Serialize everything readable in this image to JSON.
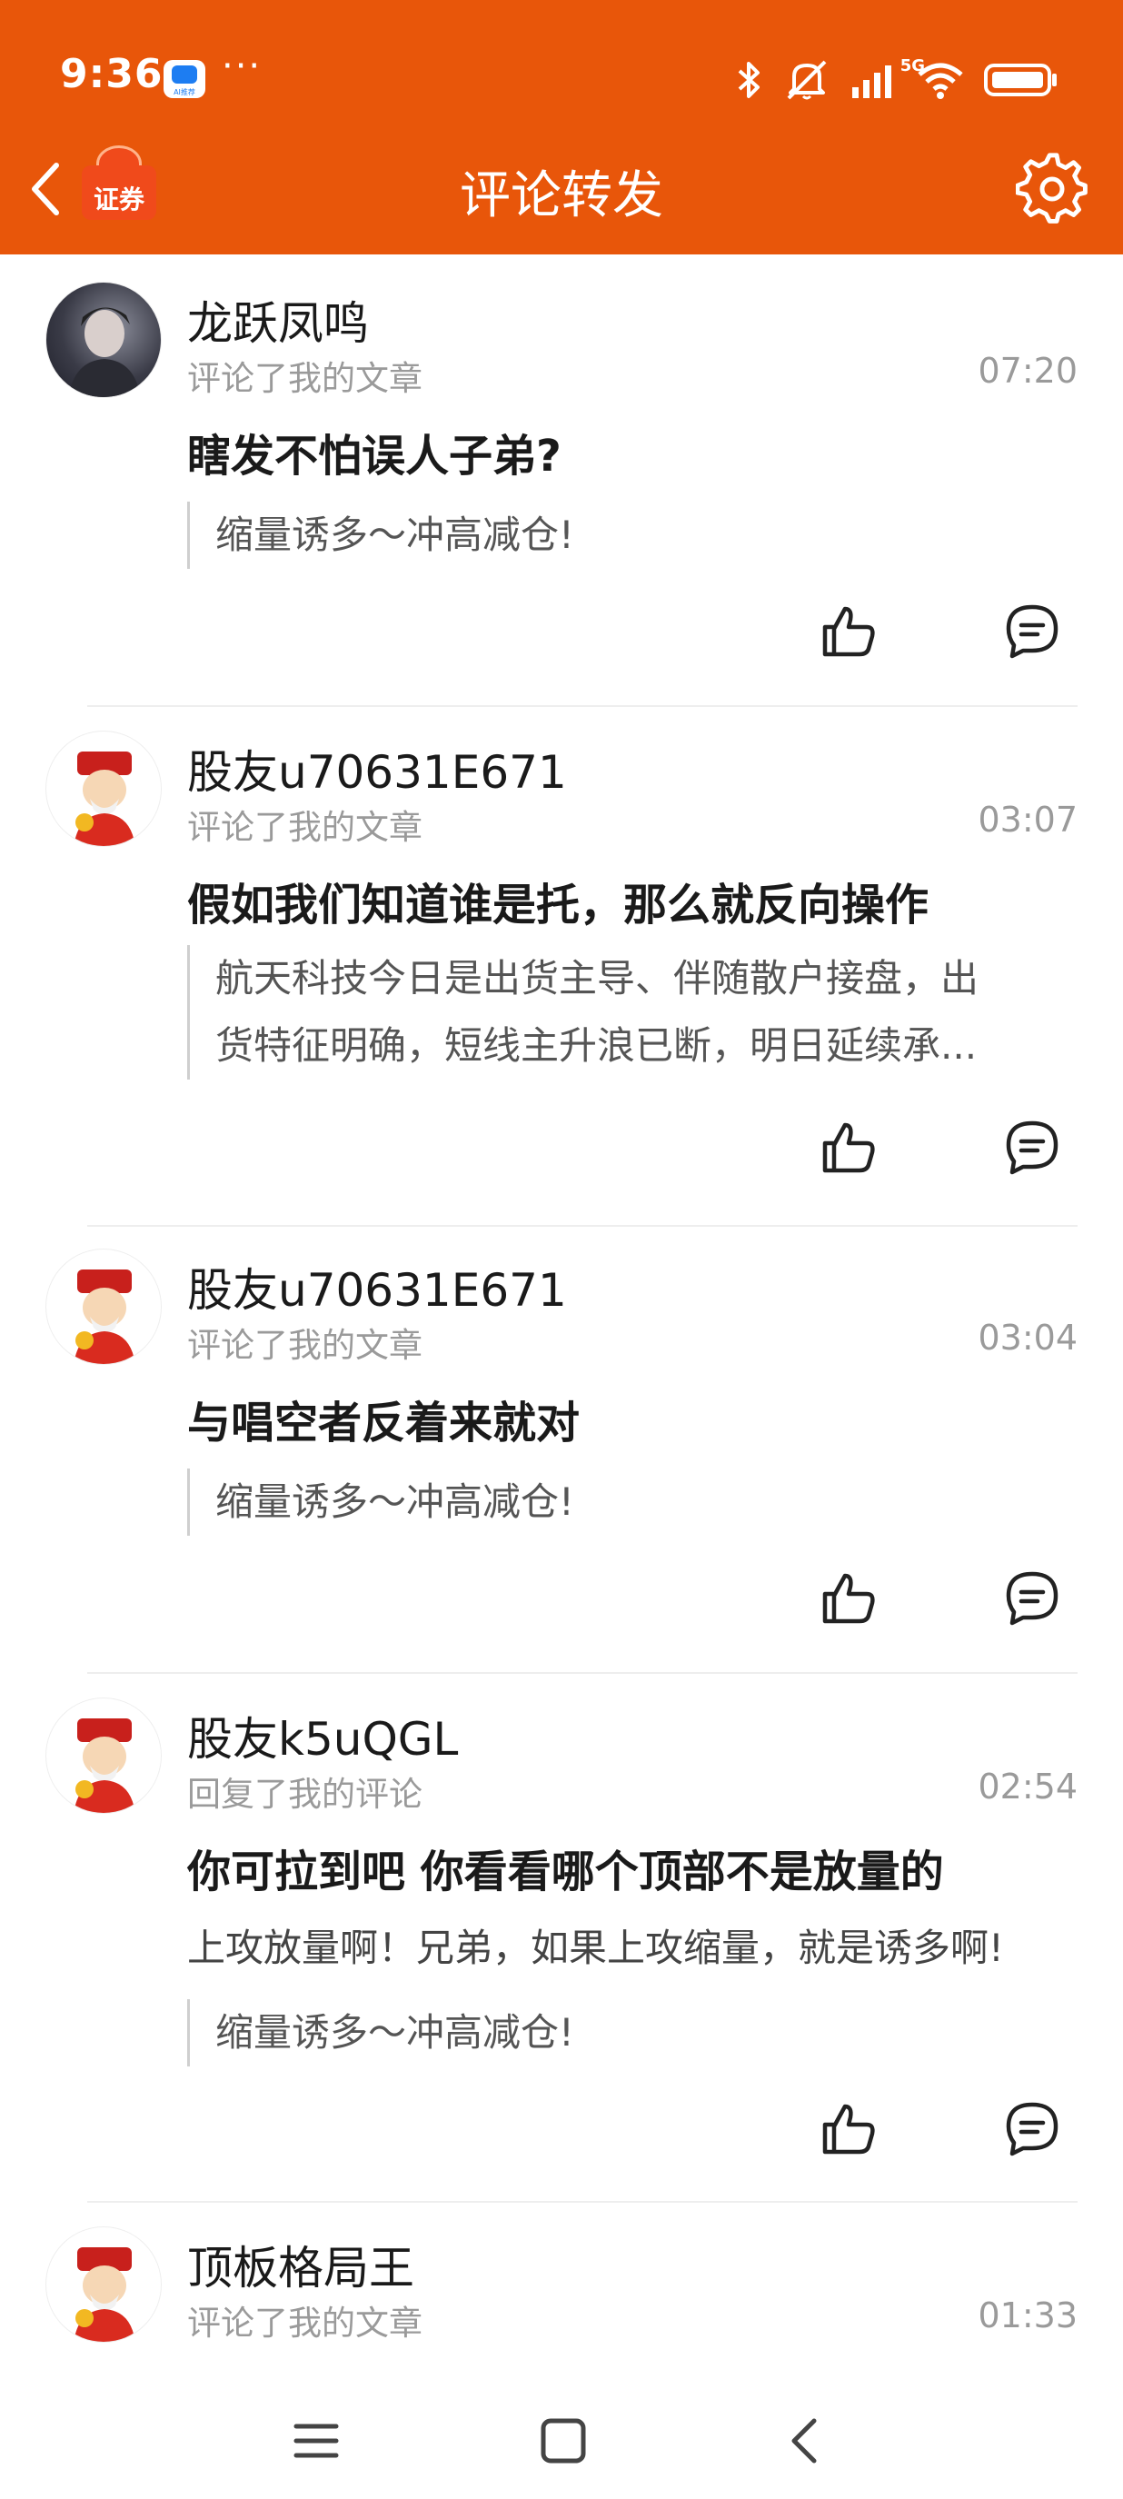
{
  "status_bar": {
    "time": "9:36",
    "app_icon_label": "AI推荐",
    "more_dots": "···",
    "network": "5G"
  },
  "header": {
    "logo_text": "证券",
    "title": "评论转发"
  },
  "items": [
    {
      "username": "龙跃凤鸣",
      "action": "评论了我的文章",
      "time": "07:20",
      "comment": "瞎发不怕误人子弟?",
      "reply": "",
      "quote_lines": [
        "缩量诱多～冲高减仓!"
      ]
    },
    {
      "username": "股友u70631E671",
      "action": "评论了我的文章",
      "time": "03:07",
      "comment": "假如我们知道谁是托，那么就反向操作",
      "reply": "",
      "quote_lines": [
        "航天科技今日是出货主导、伴随散户接盘，出",
        "货特征明确，短线主升浪已断，明日延续承..."
      ]
    },
    {
      "username": "股友u70631E671",
      "action": "评论了我的文章",
      "time": "03:04",
      "comment": "与唱空者反着来就对",
      "reply": "",
      "quote_lines": [
        "缩量诱多～冲高减仓!"
      ]
    },
    {
      "username": "股友k5uQGL",
      "action": "回复了我的评论",
      "time": "02:54",
      "comment": "你可拉到吧 你看看哪个顶部不是放量的",
      "reply": "上攻放量啊！兄弟，如果上攻缩量，就是诱多啊!",
      "quote_lines": [
        "缩量诱多～冲高减仓!"
      ]
    },
    {
      "username": "顶板格局王",
      "action": "评论了我的文章",
      "time": "01:33",
      "comment": "",
      "reply": "",
      "quote_lines": []
    }
  ],
  "colors": {
    "brand": "#e8560a",
    "muted_text": "#9a9a9a"
  },
  "icons": [
    "back-arrow-icon",
    "gear-icon",
    "like-icon",
    "comment-icon",
    "bluetooth-icon",
    "mute-icon",
    "signal-icon",
    "wifi-icon",
    "battery-icon"
  ]
}
